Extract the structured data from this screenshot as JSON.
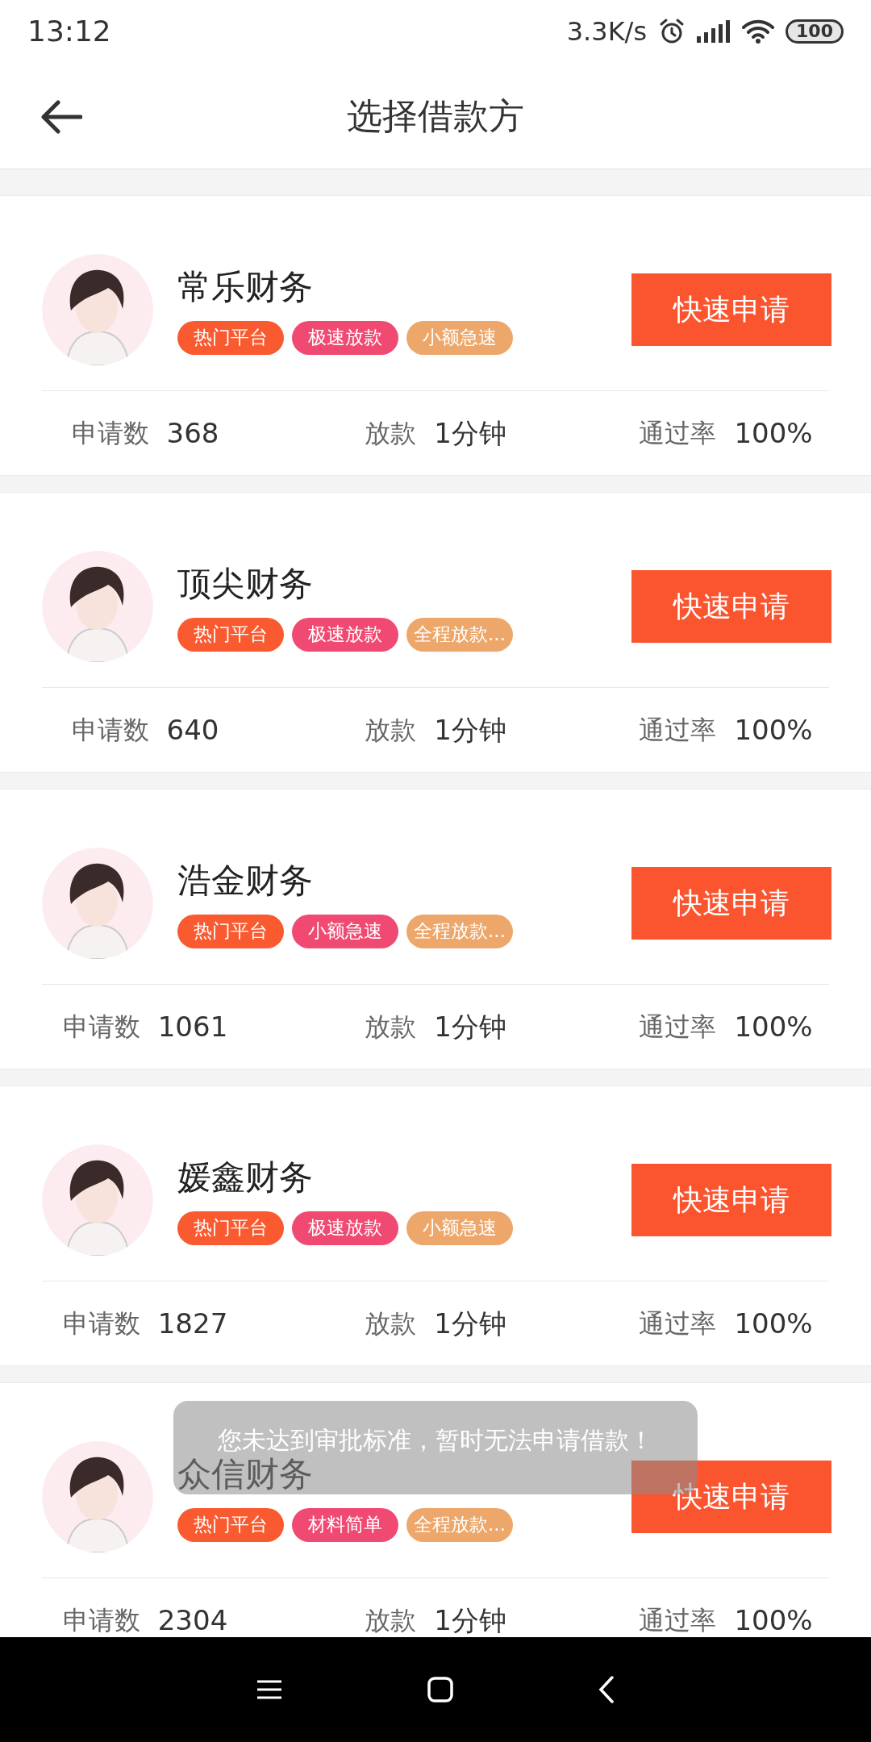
{
  "status_bar": {
    "time": "13:12",
    "network_speed": "3.3K/s",
    "battery": "100"
  },
  "header": {
    "title": "选择借款方"
  },
  "lenders": [
    {
      "name": "常乐财务",
      "tags": [
        {
          "label": "热门平台",
          "color": "#fa5a2f"
        },
        {
          "label": "极速放款",
          "color": "#f04a73"
        },
        {
          "label": "小额急速",
          "color": "#eda76a"
        }
      ],
      "button": "快速申请",
      "stats": [
        {
          "label": "申请数",
          "value": "368"
        },
        {
          "label": "放款",
          "value": "1分钟"
        },
        {
          "label": "通过率",
          "value": "100%"
        }
      ]
    },
    {
      "name": "顶尖财务",
      "tags": [
        {
          "label": "热门平台",
          "color": "#fa5a2f"
        },
        {
          "label": "极速放款",
          "color": "#f04a73"
        },
        {
          "label": "全程放款...",
          "color": "#eda76a"
        }
      ],
      "button": "快速申请",
      "stats": [
        {
          "label": "申请数",
          "value": "640"
        },
        {
          "label": "放款",
          "value": "1分钟"
        },
        {
          "label": "通过率",
          "value": "100%"
        }
      ]
    },
    {
      "name": "浩金财务",
      "tags": [
        {
          "label": "热门平台",
          "color": "#fa5a2f"
        },
        {
          "label": "小额急速",
          "color": "#f04a73"
        },
        {
          "label": "全程放款...",
          "color": "#eda76a"
        }
      ],
      "button": "快速申请",
      "stats": [
        {
          "label": "申请数",
          "value": "1061"
        },
        {
          "label": "放款",
          "value": "1分钟"
        },
        {
          "label": "通过率",
          "value": "100%"
        }
      ]
    },
    {
      "name": "媛鑫财务",
      "tags": [
        {
          "label": "热门平台",
          "color": "#fa5a2f"
        },
        {
          "label": "极速放款",
          "color": "#f04a73"
        },
        {
          "label": "小额急速",
          "color": "#eda76a"
        }
      ],
      "button": "快速申请",
      "stats": [
        {
          "label": "申请数",
          "value": "1827"
        },
        {
          "label": "放款",
          "value": "1分钟"
        },
        {
          "label": "通过率",
          "value": "100%"
        }
      ]
    },
    {
      "name": "众信财务",
      "tags": [
        {
          "label": "热门平台",
          "color": "#fa5a2f"
        },
        {
          "label": "材料简单",
          "color": "#f04a73"
        },
        {
          "label": "全程放款...",
          "color": "#eda76a"
        }
      ],
      "button": "快速申请",
      "stats": [
        {
          "label": "申请数",
          "value": "2304"
        },
        {
          "label": "放款",
          "value": "1分钟"
        },
        {
          "label": "通过率",
          "value": "100%"
        }
      ]
    }
  ],
  "toast": "您未达到审批标准，暂时无法申请借款！"
}
